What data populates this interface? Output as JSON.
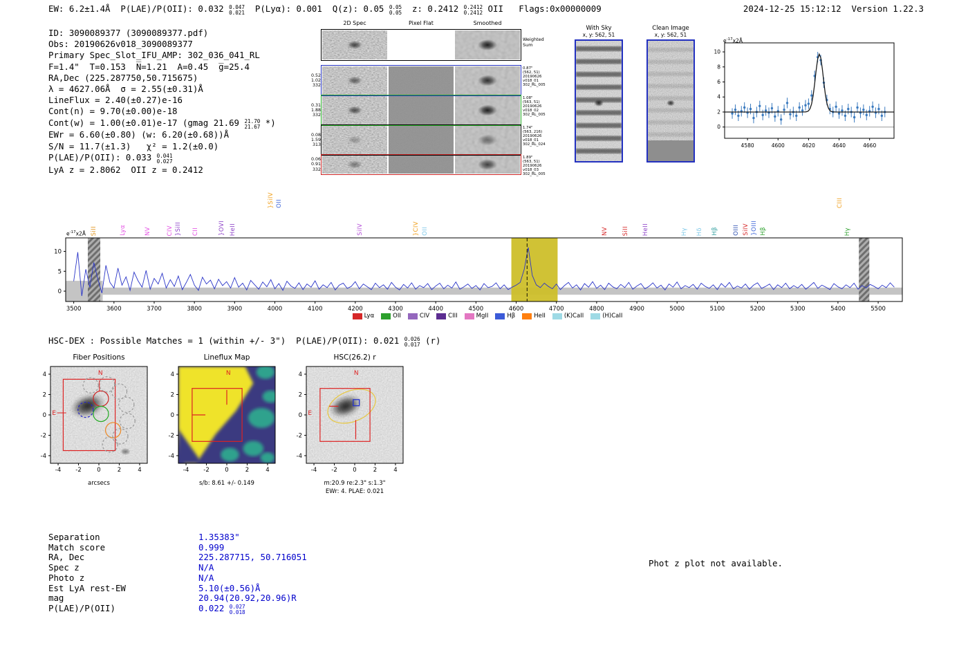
{
  "header": {
    "segments": [
      {
        "t": "EW: 6.2±1.4Å  P(LAE)/P(OII): 0.032 "
      },
      {
        "stack": [
          "0.047",
          "0.021"
        ]
      },
      {
        "t": "  P(Lyα): 0.001  Q(z): 0.05 "
      },
      {
        "stack": [
          "0.05",
          "0.05"
        ]
      },
      {
        "t": "  z: 0.2412 "
      },
      {
        "stack": [
          "0.2412",
          "0.2412"
        ]
      },
      {
        "t": " OII   Flags:0x00000009"
      }
    ],
    "timestamp": "2024-12-25 15:12:12  Version 1.22.3"
  },
  "info": {
    "lines": [
      [
        {
          "t": "ID: 3090089377 (3090089377.pdf)"
        }
      ],
      [
        {
          "t": "Obs: 20190626v018_3090089377"
        }
      ],
      [
        {
          "t": "Primary Spec_Slot_IFU_AMP: 302_036_041_RL"
        }
      ],
      [
        {
          "t": "F=1.4\"  T=0.153  N̅=1.21  A=0.45  g̅=25.4"
        }
      ],
      [
        {
          "t": "RA,Dec (225.287750,50.715675)"
        }
      ],
      [
        {
          "t": "λ = 4627.06Å  σ = 2.55(±0.31)Å"
        }
      ],
      [
        {
          "t": "LineFlux = 2.40(±0.27)e-16"
        }
      ],
      [
        {
          "t": "Cont(n) = 9.70(±0.00)e-18"
        }
      ],
      [
        {
          "t": "Cont(w) = 1.00(±0.01)e-17 (gmag 21.69 "
        },
        {
          "stack": [
            "21.70",
            "21.67"
          ]
        },
        {
          "t": " *)"
        }
      ],
      [
        {
          "t": "EWr = 6.60(±0.80) (w: 6.20(±0.68))Å"
        }
      ],
      [
        {
          "t": "S/N = 11.7(±1.3)   χ² = 1.2(±0.0)"
        }
      ],
      [
        {
          "t": "P(LAE)/P(OII): 0.033 "
        },
        {
          "stack": [
            "0.041",
            "0.027"
          ]
        }
      ],
      [
        {
          "t": "LyA z = 2.8062  OII z = 0.2412"
        }
      ]
    ]
  },
  "cutouts": {
    "col_headers": [
      "2D Spec",
      "Pixel Flat",
      "Smoothed"
    ],
    "weighted_sum": [
      "Weighted",
      "Sum"
    ],
    "rows": [
      {
        "border": "#000000",
        "left": [],
        "right": []
      },
      {
        "border": "#2230c0",
        "left": [
          "0.52",
          "1.02",
          "332"
        ],
        "right": [
          "0.87\"",
          "(562, 51)",
          "20190626",
          "v018_01",
          "302_RL_005"
        ]
      },
      {
        "border": "#22aa22",
        "left": [
          "0.31",
          "1.88",
          "332"
        ],
        "right": [
          "1.08\"",
          "(563, 51)",
          "20190626",
          "v018_02",
          "302_RL_005"
        ]
      },
      {
        "border": "#000000",
        "left": [
          "0.08",
          "1.59",
          "313"
        ],
        "right": [
          "1.74\"",
          "(563, 216)",
          "20190626",
          "v018_01",
          "302_RL_024"
        ]
      },
      {
        "border": "#cc2222",
        "left": [
          "0.06",
          "0.91",
          "332"
        ],
        "right": [
          "1.89\"",
          "(563, 51)",
          "20190626",
          "v018_03",
          "302_RL_005"
        ]
      }
    ]
  },
  "with_sky": {
    "title": "With Sky",
    "subtitle": "x, y: 562, 51"
  },
  "clean_image": {
    "title": "Clean Image",
    "subtitle": "x, y: 562, 51"
  },
  "hsc": {
    "segments": [
      {
        "t": "HSC-DEX : Possible Matches = 1 (within +/- 3\")  P(LAE)/P(OII): 0.021 "
      },
      {
        "stack": [
          "0.026",
          "0.017"
        ]
      },
      {
        "t": " (r)"
      }
    ]
  },
  "panels": [
    {
      "title": "Fiber Positions",
      "xlabel": "arcsecs",
      "ticks": [
        -4,
        -2,
        0,
        2,
        4
      ]
    },
    {
      "title": "Lineflux Map",
      "xlabel": "s/b: 8.61 +/- 0.149",
      "ticks": [
        -4,
        -2,
        0,
        2,
        4
      ]
    },
    {
      "title": "HSC(26.2) r",
      "xlabel": "m:20.9 re:2.3\" s:1.3\"",
      "xlabel2": "EWr: 4. PLAE: 0.021",
      "ticks": [
        -4,
        -2,
        0,
        2,
        4
      ]
    }
  ],
  "fiber_map": {
    "red_box": [
      -3.5,
      -3.5,
      1.6,
      3.5
    ],
    "compass": {
      "n_xy": [
        0.15,
        4.15
      ],
      "e_xy": [
        -4.4,
        0.2
      ]
    },
    "blob": {
      "cx": -1.1,
      "cy": 0.9,
      "rx": 1.7,
      "ry": 1.05,
      "rot": -18
    },
    "circles": [
      {
        "cx": 0.2,
        "cy": 1.6,
        "r": 0.75,
        "color": "#cc2222",
        "dash": false
      },
      {
        "cx": -1.3,
        "cy": 0.5,
        "r": 0.75,
        "color": "#2222cc",
        "dash": true
      },
      {
        "cx": 0.2,
        "cy": 0.1,
        "r": 0.75,
        "color": "#22aa22",
        "dash": false
      },
      {
        "cx": 1.4,
        "cy": -1.5,
        "r": 0.75,
        "color": "#ee8822",
        "dash": false
      },
      {
        "cx": -0.8,
        "cy": 2.9,
        "r": 0.75,
        "color": "#999999",
        "dash": true
      },
      {
        "cx": 0.8,
        "cy": 3.0,
        "r": 0.75,
        "color": "#999999",
        "dash": true
      },
      {
        "cx": 2.0,
        "cy": 2.3,
        "r": 0.75,
        "color": "#999999",
        "dash": true
      },
      {
        "cx": 2.7,
        "cy": 1.0,
        "r": 0.75,
        "color": "#999999",
        "dash": true
      },
      {
        "cx": 2.8,
        "cy": -0.6,
        "r": 0.75,
        "color": "#999999",
        "dash": true
      },
      {
        "cx": 2.1,
        "cy": -2.1,
        "r": 0.75,
        "color": "#999999",
        "dash": true
      },
      {
        "cx": 1.1,
        "cy": -2.9,
        "r": 0.75,
        "color": "#999999",
        "dash": true
      }
    ]
  },
  "lineflux_map": {
    "red_box": [
      -3.4,
      -2.6,
      1.5,
      2.6
    ],
    "n_xy": [
      0.15,
      4.15
    ],
    "reticle": [
      [
        0,
        2.45,
        0,
        1.0
      ],
      [
        -3.4,
        0,
        -2.1,
        0
      ]
    ]
  },
  "hsc_map": {
    "red_box": [
      -3.4,
      -2.6,
      1.5,
      2.6
    ],
    "compass": {
      "n_xy": [
        0.15,
        4.15
      ],
      "e_xy": [
        -4.4,
        0.2
      ]
    },
    "blob": {
      "cx": -0.9,
      "cy": 0.85,
      "rx": 1.6,
      "ry": 1.0,
      "rot": -20
    },
    "ellipse": {
      "cx": -0.3,
      "cy": 0.85,
      "rx": 2.45,
      "ry": 1.5,
      "rot": -22,
      "color": "#e6c84a"
    },
    "blue_box": {
      "cx": 0.15,
      "cy": 1.2,
      "size": 0.6,
      "color": "#2230cc"
    },
    "reticle": [
      [
        0.1,
        -0.5,
        0.1,
        -2.4
      ],
      [
        -2.5,
        0.85,
        -1.6,
        0.85
      ]
    ]
  },
  "match_table": {
    "rows": [
      {
        "label": "Separation",
        "value": [
          {
            "t": "1.35383\""
          }
        ]
      },
      {
        "label": "Match score",
        "value": [
          {
            "t": "0.999"
          }
        ]
      },
      {
        "label": "RA, Dec",
        "value": [
          {
            "t": "225.287715, 50.716051"
          }
        ]
      },
      {
        "label": "Spec z",
        "value": [
          {
            "t": "N/A"
          }
        ]
      },
      {
        "label": "Photo z",
        "value": [
          {
            "t": "N/A"
          }
        ]
      },
      {
        "label": "Est LyA rest-EW",
        "value": [
          {
            "t": "5.10(±0.56)Å"
          }
        ]
      },
      {
        "label": "mag",
        "value": [
          {
            "t": "20.94(20.92,20.96)R"
          }
        ]
      },
      {
        "label": "P(LAE)/P(OII)",
        "value": [
          {
            "t": "0.022 "
          },
          {
            "stack": [
              "0.027",
              "0.018"
            ]
          }
        ]
      }
    ]
  },
  "notes": {
    "photz": "Phot z plot not available."
  },
  "chart_data": [
    {
      "type": "scatter",
      "title": "Emission line fit",
      "unit_label": {
        "base": "e",
        "sup": "-17",
        "rest": "x2Å"
      },
      "x_start": 4570,
      "x_step": 2,
      "values": [
        1.8,
        2.3,
        1.5,
        2.1,
        2.6,
        1.9,
        2.4,
        1.2,
        2.0,
        2.8,
        1.6,
        2.2,
        1.9,
        2.5,
        1.4,
        2.1,
        1.0,
        2.3,
        3.2,
        1.7,
        2.0,
        1.5,
        2.6,
        2.2,
        2.9,
        3.1,
        4.2,
        6.8,
        9.3,
        8.9,
        5.9,
        3.6,
        2.4,
        2.0,
        2.7,
        1.8,
        2.2,
        1.5,
        2.4,
        2.0,
        1.3,
        2.6,
        1.9,
        2.3,
        1.6,
        2.1,
        2.7,
        1.9,
        2.4,
        1.5,
        2.0
      ],
      "yerr": 0.7,
      "fit": {
        "center": 4627.06,
        "sigma": 2.55,
        "amplitude": 7.7,
        "continuum": 2.0
      },
      "xticks": [
        4580,
        4600,
        4620,
        4640,
        4660
      ],
      "yticks": [
        0,
        2,
        4,
        6,
        8,
        10
      ],
      "xlim": [
        4565,
        4676
      ],
      "ylim": [
        -1.5,
        11.2
      ],
      "point_color": "#3a7abf",
      "fit_color": "#1a1a1a"
    },
    {
      "type": "line",
      "title": "Full spectrum",
      "unit_label": {
        "base": "e",
        "sup": "-17",
        "rest": "x2Å"
      },
      "line_color": "#2a35c8",
      "x_start": 3500,
      "x_step": 10,
      "values": [
        2.5,
        9.8,
        -1.2,
        5.5,
        1.0,
        7.2,
        3.0,
        -0.5,
        6.5,
        2.2,
        0.8,
        5.8,
        1.5,
        3.6,
        0.2,
        4.8,
        2.6,
        1.0,
        5.2,
        0.5,
        3.2,
        1.8,
        4.5,
        0.8,
        2.9,
        1.2,
        3.8,
        0.4,
        2.2,
        4.2,
        1.5,
        0.2,
        3.5,
        1.8,
        2.8,
        0.6,
        3.0,
        1.4,
        2.4,
        0.8,
        3.4,
        1.0,
        2.0,
        0.3,
        2.7,
        1.6,
        0.5,
        2.3,
        1.1,
        2.9,
        0.6,
        1.9,
        0.2,
        2.5,
        1.3,
        0.7,
        2.1,
        0.4,
        1.8,
        1.0,
        2.6,
        0.5,
        1.6,
        0.9,
        2.2,
        0.3,
        1.5,
        2.0,
        0.7,
        1.2,
        2.4,
        0.6,
        1.8,
        1.1,
        0.4,
        2.0,
        0.9,
        1.6,
        0.5,
        2.2,
        1.0,
        0.3,
        1.7,
        0.8,
        2.1,
        0.5,
        1.4,
        0.9,
        1.9,
        0.4,
        1.3,
        2.0,
        0.6,
        1.5,
        0.8,
        2.3,
        0.5,
        1.1,
        1.8,
        0.7,
        1.4,
        0.3,
        1.9,
        0.9,
        1.2,
        2.1,
        0.6,
        1.6,
        0.4,
        1.0,
        1.5,
        2.2,
        5.5,
        11.0,
        4.0,
        1.6,
        0.9,
        2.0,
        1.2,
        0.6,
        1.8,
        0.4,
        1.4,
        2.2,
        0.8,
        1.6,
        0.3,
        1.9,
        1.0,
        2.4,
        0.7,
        1.5,
        0.4,
        2.0,
        1.1,
        0.6,
        1.7,
        0.9,
        2.2,
        0.5,
        1.3,
        1.9,
        0.6,
        1.2,
        2.1,
        0.8,
        1.5,
        0.3,
        1.8,
        1.0,
        2.3,
        0.6,
        1.4,
        0.9,
        1.7,
        0.5,
        2.0,
        1.2,
        0.7,
        1.6,
        0.4,
        1.9,
        1.0,
        2.2,
        0.6,
        1.3,
        0.8,
        1.8,
        0.5,
        1.5,
        2.1,
        0.7,
        1.2,
        1.8,
        0.4,
        1.6,
        0.9,
        2.0,
        0.6,
        1.4,
        0.8,
        1.7,
        0.5,
        1.3,
        2.2,
        0.7,
        1.5,
        1.0,
        0.4,
        1.9,
        1.1,
        0.6,
        1.6,
        0.9,
        2.0,
        0.5,
        1.4,
        0.8,
        1.7,
        1.2,
        0.6,
        1.5,
        0.9,
        2.1,
        1.0
      ],
      "xticks": [
        3500,
        3600,
        3700,
        3800,
        3900,
        4000,
        4100,
        4200,
        4300,
        4400,
        4500,
        4600,
        4700,
        4800,
        4900,
        5000,
        5100,
        5200,
        5300,
        5400,
        5500
      ],
      "yticks": [
        0,
        5,
        10
      ],
      "xlim": [
        3480,
        5560
      ],
      "ylim": [
        -2.6,
        13.4
      ],
      "highlight_band": {
        "x0": 4588,
        "x1": 4703,
        "color": "#cdbf2a"
      },
      "noise_band": {
        "halfwidth": 0.9,
        "left_halfwidth": 2.6,
        "left_until": 3572,
        "color": "#c4c4c4"
      },
      "masked_regions": [
        [
          3535,
          3566
        ],
        [
          5452,
          5478
        ]
      ],
      "line_marker": 4627.06,
      "emission_labels": [
        {
          "x": 3550,
          "text": "SiII",
          "color": "#e0941c"
        },
        {
          "x": 3622,
          "text": "Lyα",
          "color": "#e34fe3"
        },
        {
          "x": 3684,
          "text": "NV",
          "color": "#e34fe3"
        },
        {
          "x": 3740,
          "text": "CIV",
          "color": "#e34fe3"
        },
        {
          "x": 3760,
          "text": "}SiII",
          "color": "#8d40c8"
        },
        {
          "x": 3804,
          "text": "CII",
          "color": "#e34fe3"
        },
        {
          "x": 3868,
          "text": "}OVI",
          "color": "#8d40c8"
        },
        {
          "x": 3896,
          "text": "HeII",
          "color": "#8d40c8"
        },
        {
          "x": 3990,
          "text": "}SiIV",
          "color": "#f0a01e",
          "tall": true
        },
        {
          "x": 4012,
          "text": "OII",
          "color": "#3c64d8",
          "tall": true
        },
        {
          "x": 4212,
          "text": "SiIV",
          "color": "#b44fd8"
        },
        {
          "x": 4352,
          "text": "}CIV",
          "color": "#f0a01e"
        },
        {
          "x": 4374,
          "text": "OII",
          "color": "#7ec8e8"
        },
        {
          "x": 4820,
          "text": "NV",
          "color": "#d62728"
        },
        {
          "x": 4872,
          "text": "SiII",
          "color": "#d62728"
        },
        {
          "x": 4922,
          "text": "HeII",
          "color": "#8d40c8"
        },
        {
          "x": 5018,
          "text": "Hγ",
          "color": "#7ec8e8"
        },
        {
          "x": 5056,
          "text": "Hδ",
          "color": "#7ec8e8"
        },
        {
          "x": 5094,
          "text": "Hβ",
          "color": "#2f9e9e"
        },
        {
          "x": 5148,
          "text": "OIII",
          "color": "#2c4fb0"
        },
        {
          "x": 5172,
          "text": "SiIV",
          "color": "#d62728"
        },
        {
          "x": 5192,
          "text": "}OIII",
          "color": "#3c64d8"
        },
        {
          "x": 5214,
          "text": "Hβ",
          "color": "#2ca02c"
        },
        {
          "x": 5406,
          "text": "CIII",
          "color": "#f0a01e",
          "tall": true
        },
        {
          "x": 5424,
          "text": "Hγ",
          "color": "#2ca02c"
        }
      ],
      "legend": [
        {
          "label": "Lyα",
          "color": "#d62728"
        },
        {
          "label": "OII",
          "color": "#2ca02c"
        },
        {
          "label": "CIV",
          "color": "#9467bd"
        },
        {
          "label": "CIII",
          "color": "#5c2d91"
        },
        {
          "label": "MgII",
          "color": "#e377c2"
        },
        {
          "label": "Hβ",
          "color": "#3c5bd8"
        },
        {
          "label": "HeII",
          "color": "#ff7f0e"
        },
        {
          "label": "(K)CaII",
          "color": "#9edae5"
        },
        {
          "label": "(H)CaII",
          "color": "#9edae5"
        }
      ]
    }
  ]
}
